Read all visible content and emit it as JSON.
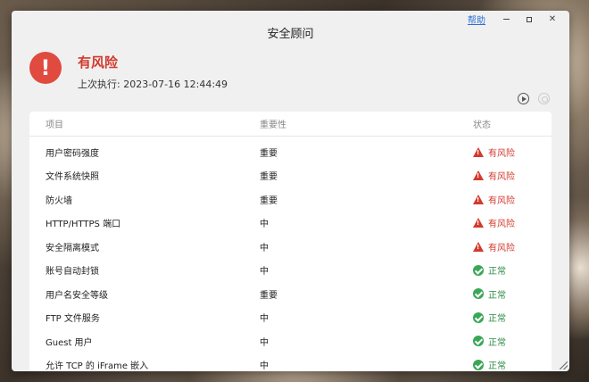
{
  "window": {
    "title": "安全顾问",
    "help_label": "帮助",
    "minimize": "",
    "maximize": "",
    "close_label": "✕"
  },
  "status": {
    "icon_glyph": "!",
    "title": "有风险",
    "last_run": "上次执行: 2023-07-16 12:44:49",
    "accent_color": "#d23a2d"
  },
  "table": {
    "headers": {
      "item": "项目",
      "importance": "重要性",
      "status": "状态"
    },
    "rows": [
      {
        "item": "用户密码强度",
        "importance": "重要",
        "status": "有风险",
        "state": "risk"
      },
      {
        "item": "文件系统快照",
        "importance": "重要",
        "status": "有风险",
        "state": "risk"
      },
      {
        "item": "防火墙",
        "importance": "重要",
        "status": "有风险",
        "state": "risk"
      },
      {
        "item": "HTTP/HTTPS 端口",
        "importance": "中",
        "status": "有风险",
        "state": "risk"
      },
      {
        "item": "安全隔离模式",
        "importance": "中",
        "status": "有风险",
        "state": "risk"
      },
      {
        "item": "账号自动封锁",
        "importance": "中",
        "status": "正常",
        "state": "ok"
      },
      {
        "item": "用户名安全等级",
        "importance": "重要",
        "status": "正常",
        "state": "ok"
      },
      {
        "item": "FTP 文件服务",
        "importance": "中",
        "status": "正常",
        "state": "ok"
      },
      {
        "item": "Guest 用户",
        "importance": "中",
        "status": "正常",
        "state": "ok"
      },
      {
        "item": "允许 TCP 的 iFrame 嵌入",
        "importance": "中",
        "status": "正常",
        "state": "ok"
      }
    ]
  },
  "colors": {
    "risk": "#d23a2d",
    "ok": "#3aa757"
  }
}
